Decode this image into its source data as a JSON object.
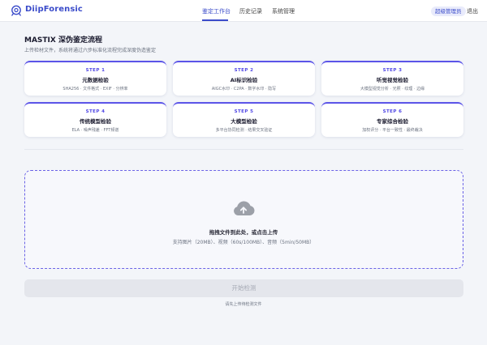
{
  "app": {
    "brand": "DiipForensic",
    "logo_icon": "shield-check-icon",
    "accent_color": "#3b4cca"
  },
  "nav": {
    "items": [
      {
        "label": "鉴定工作台",
        "active": true
      },
      {
        "label": "历史记录",
        "active": false
      },
      {
        "label": "系统管理",
        "active": false
      }
    ],
    "admin_badge": "超级管理员",
    "logout": "退出"
  },
  "page": {
    "title": "MASTIX 深伪鉴定流程",
    "subtitle": "上传检材文件，系统将通过六步标准化流程完成深度伪造鉴定"
  },
  "steps": [
    {
      "num": "STEP 1",
      "title": "元数据检验",
      "desc": "SHA256 · 文件格式 · EXIF · 分辨率"
    },
    {
      "num": "STEP 2",
      "title": "AI标识检验",
      "desc": "AIGC水印 · C2PA · 数字水印 · 隐写"
    },
    {
      "num": "STEP 3",
      "title": "听觉视觉检验",
      "desc": "大模型视觉分析 · 光照 · 纹理 · 边缘"
    },
    {
      "num": "STEP 4",
      "title": "传统模型检验",
      "desc": "ELA · 噪声残差 · FFT频谱"
    },
    {
      "num": "STEP 5",
      "title": "大模型检验",
      "desc": "多平台协同检测 · 结果交叉验证"
    },
    {
      "num": "STEP 6",
      "title": "专家综合检验",
      "desc": "加权评分 · 平台一致性 · 最终裁决"
    }
  ],
  "upload": {
    "icon": "cloud-upload-icon",
    "title": "拖拽文件到此处，或点击上传",
    "hint": "支持图片（20MB）、视频（60s/100MB）、音频（5min/50MB）"
  },
  "action": {
    "start_label": "开始检测",
    "hint": "请先上传待检测文件"
  }
}
